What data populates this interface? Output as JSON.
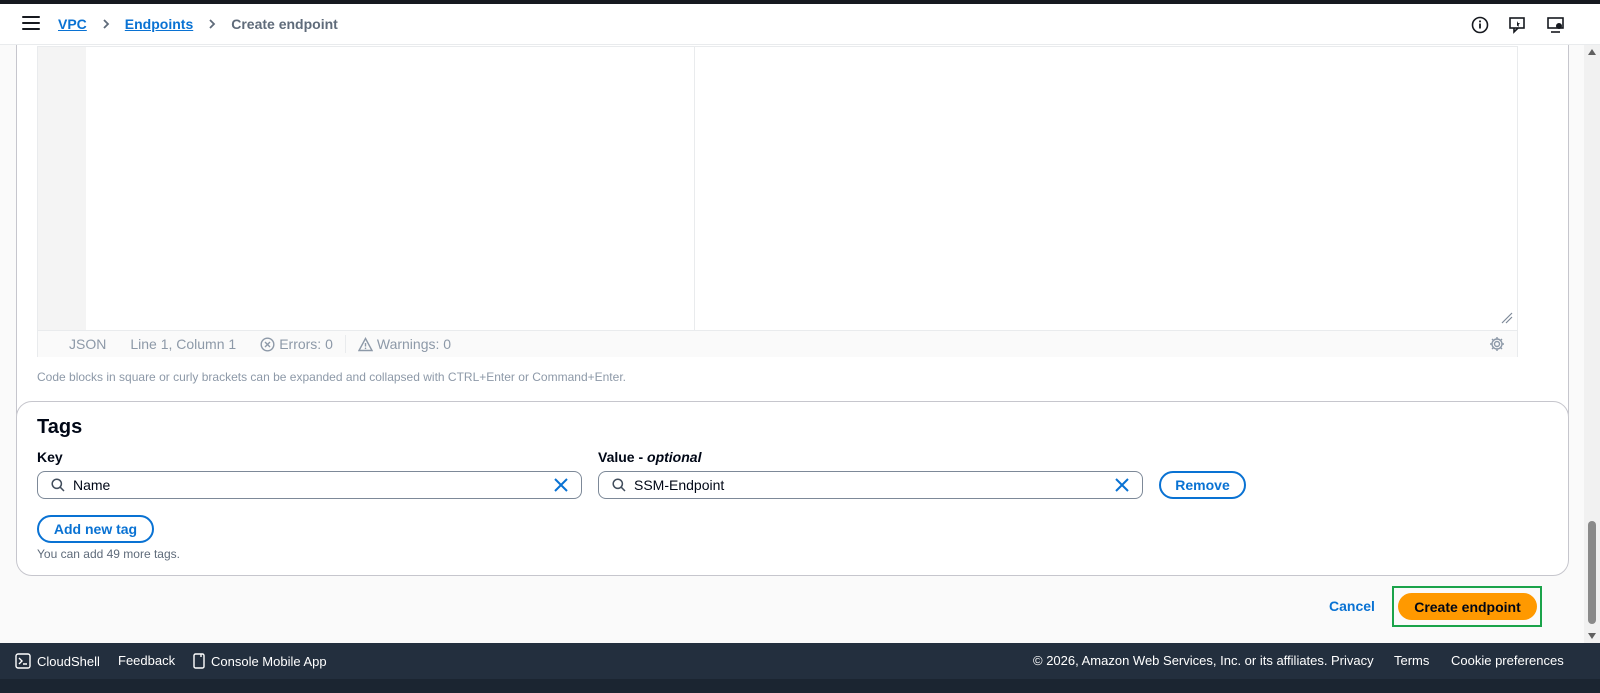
{
  "header": {
    "breadcrumbs": [
      "VPC",
      "Endpoints"
    ],
    "current": "Create endpoint",
    "icons": [
      "info-icon",
      "feedback-icon",
      "preferences-icon"
    ]
  },
  "editor": {
    "language": "JSON",
    "position": "Line 1, Column 1",
    "errors": "Errors: 0",
    "warnings": "Warnings: 0",
    "hint": "Code blocks in square or curly brackets can be expanded and collapsed with CTRL+Enter or Command+Enter."
  },
  "tags": {
    "title": "Tags",
    "key_label": "Key",
    "value_label_prefix": "Value - ",
    "value_label_suffix": "optional",
    "rows": [
      {
        "key": "Name",
        "value": "SSM-Endpoint"
      }
    ],
    "remove_label": "Remove",
    "add_label": "Add new tag",
    "help": "You can add 49 more tags."
  },
  "actions": {
    "cancel": "Cancel",
    "create": "Create endpoint"
  },
  "footer": {
    "cloudshell": "CloudShell",
    "feedback": "Feedback",
    "mobile_app": "Console Mobile App",
    "copyright": "© 2026, Amazon Web Services, Inc. or its affiliates.",
    "privacy": "Privacy",
    "terms": "Terms",
    "cookies": "Cookie preferences"
  },
  "colors": {
    "accent": "#0972d3",
    "primary_button": "#ff9900",
    "footer_bg": "#232f3e",
    "highlight_border": "#1aa34a"
  }
}
